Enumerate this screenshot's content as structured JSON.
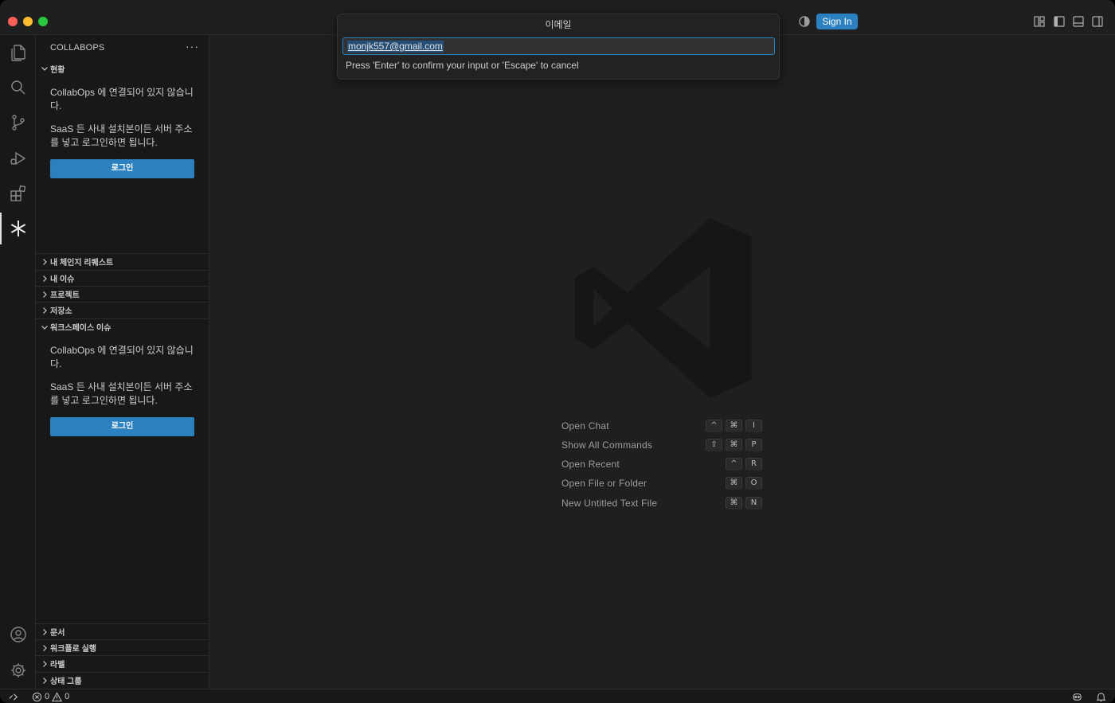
{
  "titlebar": {
    "sign_in_label": "Sign In"
  },
  "quick_input": {
    "title": "이메일",
    "value": "monjk557@gmail.com",
    "hint": "Press 'Enter' to confirm your input or 'Escape' to cancel"
  },
  "activitybar": {
    "items": [
      "explorer-icon",
      "search-icon",
      "source-control-icon",
      "run-debug-icon",
      "extensions-icon",
      "collabops-icon"
    ],
    "bottom": [
      "account-icon",
      "gear-icon"
    ]
  },
  "sidebar": {
    "title": "COLLABOPS",
    "more": "···",
    "status_section": {
      "label": "현황",
      "msg1": "CollabOps 에 연결되어 있지 않습니다.",
      "msg2": "SaaS 든 사내 설치본이든 서버 주소를 넣고 로그인하면 됩니다.",
      "login_label": "로그인"
    },
    "sections": [
      {
        "label": "내 체인지 리퀘스트"
      },
      {
        "label": "내 이슈"
      },
      {
        "label": "프로젝트"
      },
      {
        "label": "저장소"
      }
    ],
    "workspace_section": {
      "label": "워크스페이스 이슈",
      "msg1": "CollabOps 에 연결되어 있지 않습니다.",
      "msg2": "SaaS 든 사내 설치본이든 서버 주소를 넣고 로그인하면 됩니다.",
      "login_label": "로그인"
    },
    "bottom_sections": [
      {
        "label": "문서"
      },
      {
        "label": "워크플로 실행"
      },
      {
        "label": "라벨"
      },
      {
        "label": "상태 그룹"
      }
    ]
  },
  "editor": {
    "shortcuts": [
      {
        "label": "Open Chat",
        "keys": [
          "^",
          "⌘",
          "I"
        ]
      },
      {
        "label": "Show All Commands",
        "keys": [
          "⇧",
          "⌘",
          "P"
        ]
      },
      {
        "label": "Open Recent",
        "keys": [
          "^",
          "R"
        ]
      },
      {
        "label": "Open File or Folder",
        "keys": [
          "⌘",
          "O"
        ]
      },
      {
        "label": "New Untitled Text File",
        "keys": [
          "⌘",
          "N"
        ]
      }
    ]
  },
  "statusbar": {
    "errors": "0",
    "warnings": "0"
  }
}
